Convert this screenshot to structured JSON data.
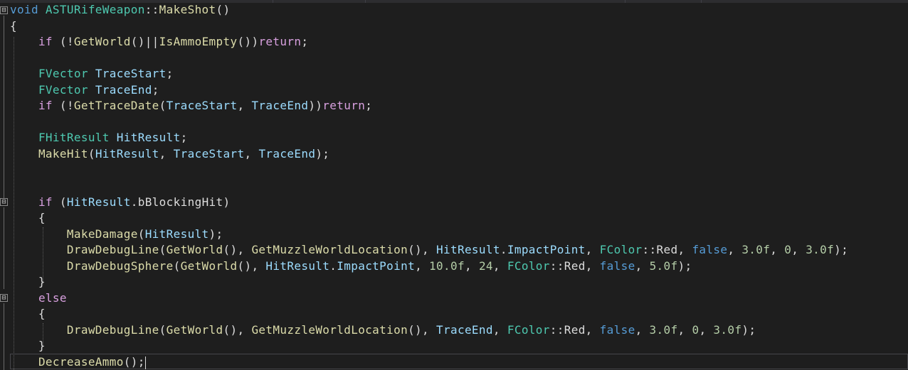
{
  "editor": {
    "fold_markers": [
      "⊟",
      "⊟",
      "⊟"
    ],
    "lines": {
      "l01": {
        "a": "void",
        "b": " ",
        "c": "ASTURifeWeapon",
        "d": "::",
        "e": "MakeShot",
        "f": "()"
      },
      "l02": {
        "a": "{"
      },
      "l03": {
        "a": "    ",
        "b": "if",
        "c": " (!",
        "d": "GetWorld",
        "e": "()||",
        "f": "IsAmmoEmpty",
        "g": "())",
        "h": "return",
        "i": ";"
      },
      "l05": {
        "a": "    ",
        "b": "FVector",
        "c": " ",
        "d": "TraceStart",
        "e": ";"
      },
      "l06": {
        "a": "    ",
        "b": "FVector",
        "c": " ",
        "d": "TraceEnd",
        "e": ";"
      },
      "l07": {
        "a": "    ",
        "b": "if",
        "c": " (!",
        "d": "GetTraceDate",
        "e": "(",
        "f": "TraceStart",
        "g": ", ",
        "h": "TraceEnd",
        "i": "))",
        "j": "return",
        "k": ";"
      },
      "l09": {
        "a": "    ",
        "b": "FHitResult",
        "c": " ",
        "d": "HitResult",
        "e": ";"
      },
      "l10": {
        "a": "    ",
        "b": "MakeHit",
        "c": "(",
        "d": "HitResult",
        "e": ", ",
        "f": "TraceStart",
        "g": ", ",
        "h": "TraceEnd",
        "i": ");"
      },
      "l13": {
        "a": "    ",
        "b": "if",
        "c": " (",
        "d": "HitResult",
        "e": ".",
        "f": "bBlockingHit",
        "g": ")"
      },
      "l14": {
        "a": "    {"
      },
      "l15": {
        "a": "        ",
        "b": "MakeDamage",
        "c": "(",
        "d": "HitResult",
        "e": ");"
      },
      "l16": {
        "a": "        ",
        "b": "DrawDebugLine",
        "c": "(",
        "d": "GetWorld",
        "e": "(), ",
        "f": "GetMuzzleWorldLocation",
        "g": "(), ",
        "h": "HitResult",
        "i": ".",
        "j": "ImpactPoint",
        "k": ", ",
        "l": "FColor",
        "m": "::Red, ",
        "n": "false",
        "o": ", ",
        "p": "3.0f",
        "q": ", ",
        "r": "0",
        "s": ", ",
        "t": "3.0f",
        "u": ");"
      },
      "l17": {
        "a": "        ",
        "b": "DrawDebugSphere",
        "c": "(",
        "d": "GetWorld",
        "e": "(), ",
        "f": "HitResult",
        "g": ".",
        "h": "ImpactPoint",
        "i": ", ",
        "j": "10.0f",
        "k": ", ",
        "l": "24",
        "m": ", ",
        "n": "FColor",
        "o": "::Red, ",
        "p": "false",
        "q": ", ",
        "r": "5.0f",
        "s": ");"
      },
      "l18": {
        "a": "    }"
      },
      "l19": {
        "a": "    ",
        "b": "else"
      },
      "l20": {
        "a": "    {"
      },
      "l21": {
        "a": "        ",
        "b": "DrawDebugLine",
        "c": "(",
        "d": "GetWorld",
        "e": "(), ",
        "f": "GetMuzzleWorldLocation",
        "g": "(), ",
        "h": "TraceEnd",
        "i": ", ",
        "j": "FColor",
        "k": "::Red, ",
        "l": "false",
        "m": ", ",
        "n": "3.0f",
        "o": ", ",
        "p": "0",
        "q": ", ",
        "r": "3.0f",
        "s": ");"
      },
      "l22": {
        "a": "    }"
      },
      "l23": {
        "a": "    ",
        "b": "DecreaseAmmo",
        "c": "();"
      }
    }
  }
}
